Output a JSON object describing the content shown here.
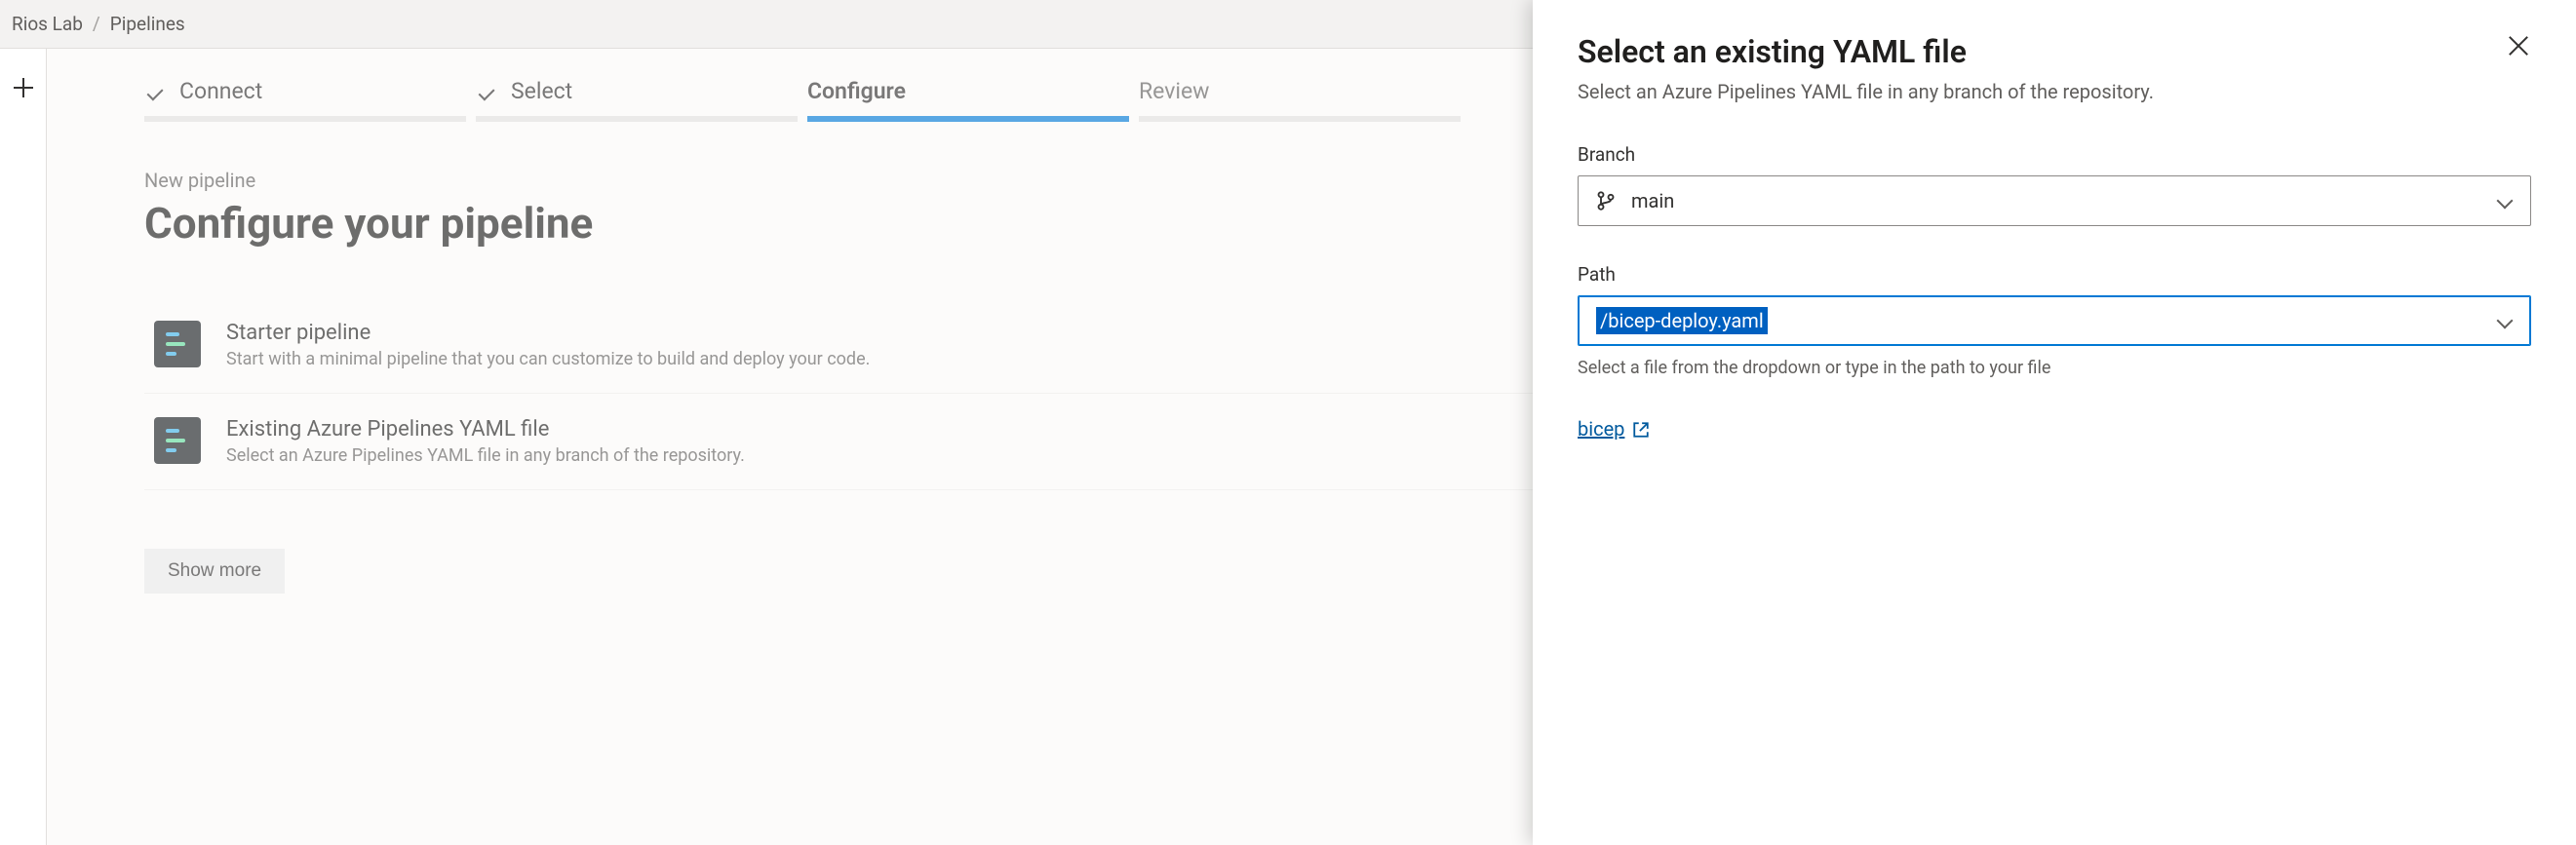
{
  "breadcrumb": {
    "project": "Rios Lab",
    "section": "Pipelines"
  },
  "stepper": {
    "connect": "Connect",
    "select": "Select",
    "configure": "Configure",
    "review": "Review"
  },
  "main": {
    "subheading": "New pipeline",
    "heading": "Configure your pipeline",
    "option_starter_title": "Starter pipeline",
    "option_starter_desc": "Start with a minimal pipeline that you can customize to build and deploy your code.",
    "option_existing_title": "Existing Azure Pipelines YAML file",
    "option_existing_desc": "Select an Azure Pipelines YAML file in any branch of the repository.",
    "show_more": "Show more"
  },
  "panel": {
    "title": "Select an existing YAML file",
    "subtitle": "Select an Azure Pipelines YAML file in any branch of the repository.",
    "branch_label": "Branch",
    "branch_value": "main",
    "path_label": "Path",
    "path_value": "/bicep-deploy.yaml",
    "path_help": "Select a file from the dropdown or type in the path to your file",
    "repo_link": "bicep"
  }
}
